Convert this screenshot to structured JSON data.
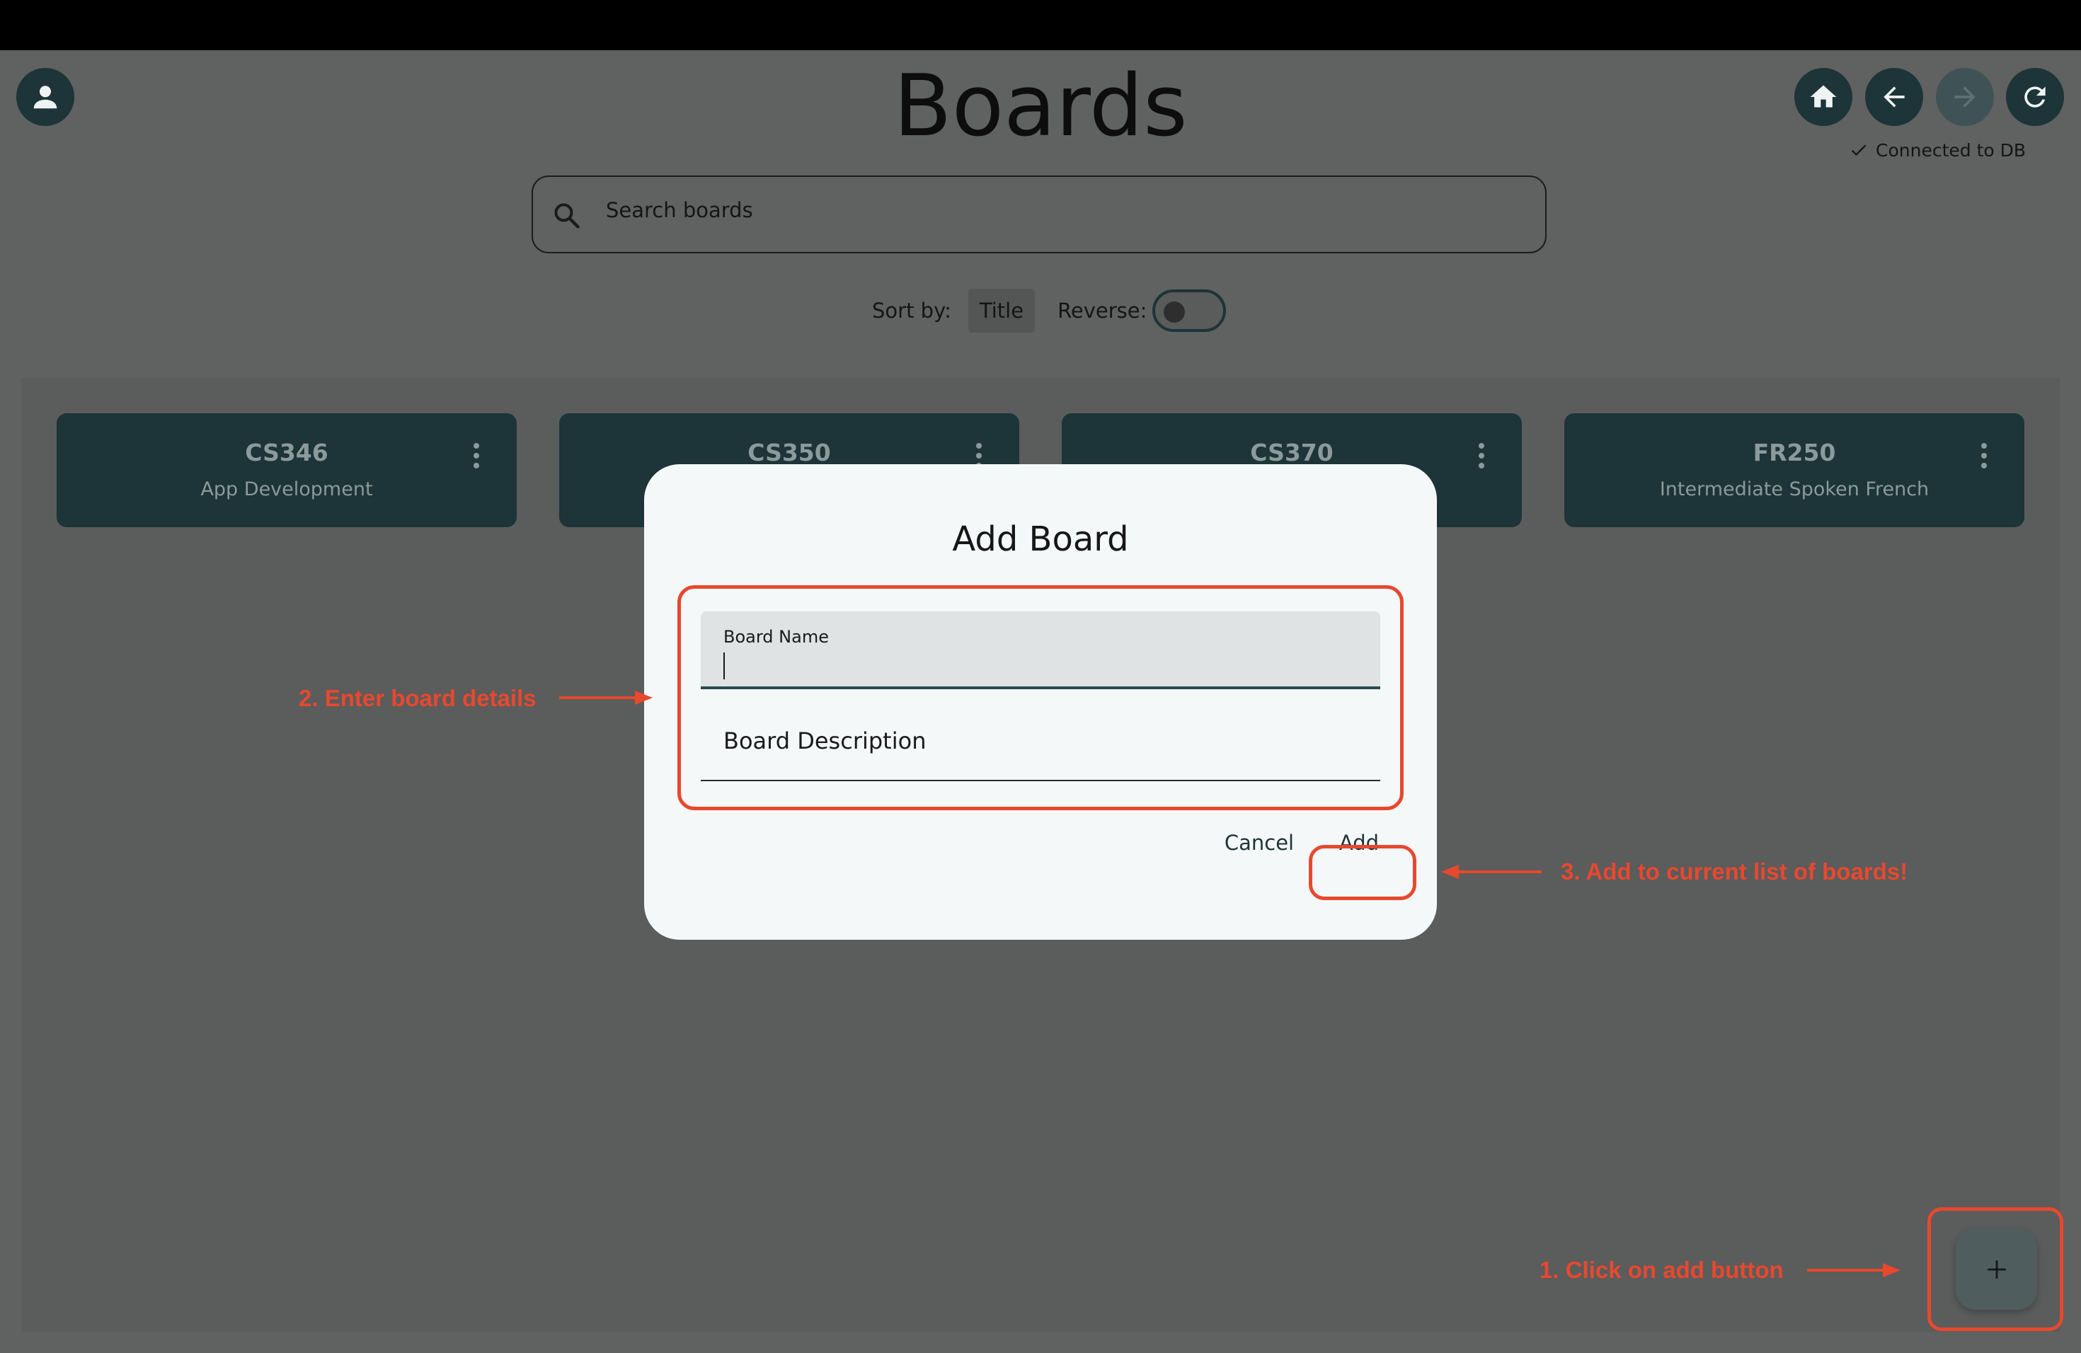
{
  "header": {
    "title": "Boards",
    "avatar_icon": "account-icon",
    "nav": [
      {
        "name": "home",
        "icon": "home-icon",
        "enabled": true
      },
      {
        "name": "back",
        "icon": "arrow-left-icon",
        "enabled": true
      },
      {
        "name": "forward",
        "icon": "arrow-right-icon",
        "enabled": false
      },
      {
        "name": "refresh",
        "icon": "refresh-icon",
        "enabled": true
      }
    ],
    "db_status": "Connected to DB"
  },
  "search": {
    "placeholder": "Search boards",
    "icon": "search-icon"
  },
  "sort": {
    "label": "Sort by:",
    "value": "Title",
    "reverse_label": "Reverse:",
    "reverse_on": false
  },
  "boards": [
    {
      "code": "CS346",
      "description": "App Development"
    },
    {
      "code": "CS350",
      "description": ""
    },
    {
      "code": "CS370",
      "description": ""
    },
    {
      "code": "FR250",
      "description": "Intermediate Spoken French"
    }
  ],
  "dialog": {
    "title": "Add Board",
    "fields": {
      "name_label": "Board Name",
      "name_value": "",
      "description_label": "Board Description",
      "description_value": ""
    },
    "cancel_label": "Cancel",
    "add_label": "Add"
  },
  "fab": {
    "icon": "plus-icon"
  },
  "annotations": {
    "step1": "1. Click on add button",
    "step2": "2. Enter board details",
    "step3": "3. Add to current list of boards!",
    "color": "#e8482e"
  },
  "colors": {
    "primary": "#1d3438",
    "overlay_background": "#606161",
    "dialog_background": "#f5f8f9"
  }
}
